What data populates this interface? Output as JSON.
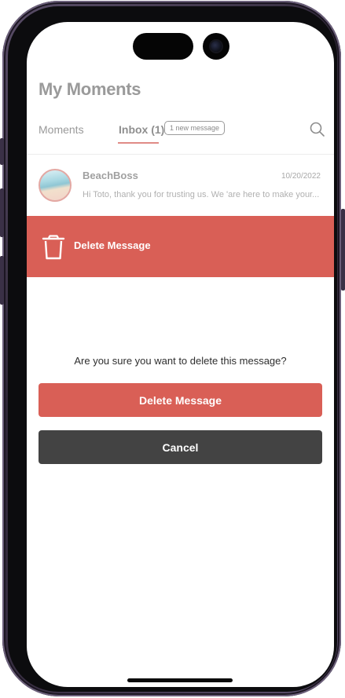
{
  "header": {
    "title": "My Moments"
  },
  "tabs": {
    "moments_label": "Moments",
    "inbox_label": "Inbox (1)",
    "new_badge": "1 new message",
    "search_icon": "search-icon"
  },
  "message": {
    "sender": "BeachBoss",
    "date": "10/20/2022",
    "preview": "Hi Toto, thank you for trusting us. We 'are here to make your..."
  },
  "swipe_action": {
    "icon": "trash-icon",
    "label": "Delete Message"
  },
  "dialog": {
    "question": "Are you sure you want to delete this message?",
    "confirm_label": "Delete Message",
    "cancel_label": "Cancel"
  },
  "colors": {
    "accent": "#d95f56",
    "cancel": "#434343",
    "tab_underline": "#e08b86"
  }
}
